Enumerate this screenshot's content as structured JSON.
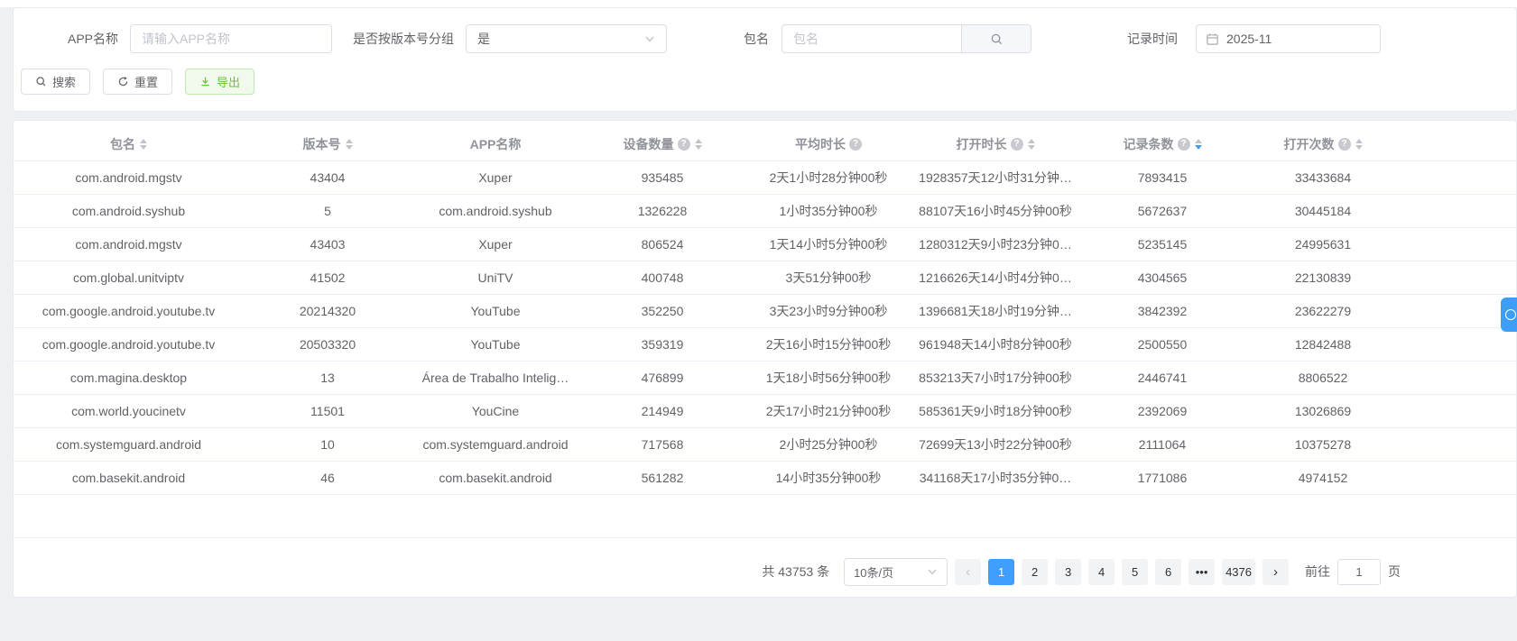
{
  "filters": {
    "app_name": {
      "label": "APP名称",
      "placeholder": "请输入APP名称",
      "value": ""
    },
    "group_by_version": {
      "label": "是否按版本号分组",
      "value": "是"
    },
    "package_name": {
      "label": "包名",
      "placeholder": "包名",
      "value": ""
    },
    "record_time": {
      "label": "记录时间",
      "value": "2025-11"
    }
  },
  "buttons": {
    "search": "搜索",
    "reset": "重置",
    "export": "导出"
  },
  "table": {
    "columns": [
      {
        "label": "包名",
        "sortable": true,
        "help": false,
        "sort": ""
      },
      {
        "label": "版本号",
        "sortable": true,
        "help": false,
        "sort": ""
      },
      {
        "label": "APP名称",
        "sortable": false,
        "help": false,
        "sort": ""
      },
      {
        "label": "设备数量",
        "sortable": true,
        "help": true,
        "sort": ""
      },
      {
        "label": "平均时长",
        "sortable": false,
        "help": true,
        "sort": ""
      },
      {
        "label": "打开时长",
        "sortable": true,
        "help": true,
        "sort": ""
      },
      {
        "label": "记录条数",
        "sortable": true,
        "help": true,
        "sort": "desc"
      },
      {
        "label": "打开次数",
        "sortable": true,
        "help": true,
        "sort": ""
      }
    ],
    "rows": [
      [
        "com.android.mgstv",
        "43404",
        "Xuper",
        "935485",
        "2天1小时28分钟00秒",
        "1928357天12小时31分钟…",
        "7893415",
        "33433684"
      ],
      [
        "com.android.syshub",
        "5",
        "com.android.syshub",
        "1326228",
        "1小时35分钟00秒",
        "88107天16小时45分钟00秒",
        "5672637",
        "30445184"
      ],
      [
        "com.android.mgstv",
        "43403",
        "Xuper",
        "806524",
        "1天14小时5分钟00秒",
        "1280312天9小时23分钟0…",
        "5235145",
        "24995631"
      ],
      [
        "com.global.unitviptv",
        "41502",
        "UniTV",
        "400748",
        "3天51分钟00秒",
        "1216626天14小时4分钟0…",
        "4304565",
        "22130839"
      ],
      [
        "com.google.android.youtube.tv",
        "20214320",
        "YouTube",
        "352250",
        "3天23小时9分钟00秒",
        "1396681天18小时19分钟…",
        "3842392",
        "23622279"
      ],
      [
        "com.google.android.youtube.tv",
        "20503320",
        "YouTube",
        "359319",
        "2天16小时15分钟00秒",
        "961948天14小时8分钟00秒",
        "2500550",
        "12842488"
      ],
      [
        "com.magina.desktop",
        "13",
        "Área de Trabalho Intelig…",
        "476899",
        "1天18小时56分钟00秒",
        "853213天7小时17分钟00秒",
        "2446741",
        "8806522"
      ],
      [
        "com.world.youcinetv",
        "11501",
        "YouCine",
        "214949",
        "2天17小时21分钟00秒",
        "585361天9小时18分钟00秒",
        "2392069",
        "13026869"
      ],
      [
        "com.systemguard.android",
        "10",
        "com.systemguard.android",
        "717568",
        "2小时25分钟00秒",
        "72699天13小时22分钟00秒",
        "2111064",
        "10375278"
      ],
      [
        "com.basekit.android",
        "46",
        "com.basekit.android",
        "561282",
        "14小时35分钟00秒",
        "341168天17小时35分钟0…",
        "1771086",
        "4974152"
      ]
    ]
  },
  "pagination": {
    "total": "共 43753 条",
    "page_size": "10条/页",
    "prev": "‹",
    "next": "›",
    "pages": [
      "1",
      "2",
      "3",
      "4",
      "5",
      "6",
      "•••",
      "4376"
    ],
    "active_page": "1",
    "goto_label": "前往",
    "goto_value": "1",
    "page_unit": "页"
  },
  "colors": {
    "accent": "#409eff",
    "success": "#67c23a"
  }
}
